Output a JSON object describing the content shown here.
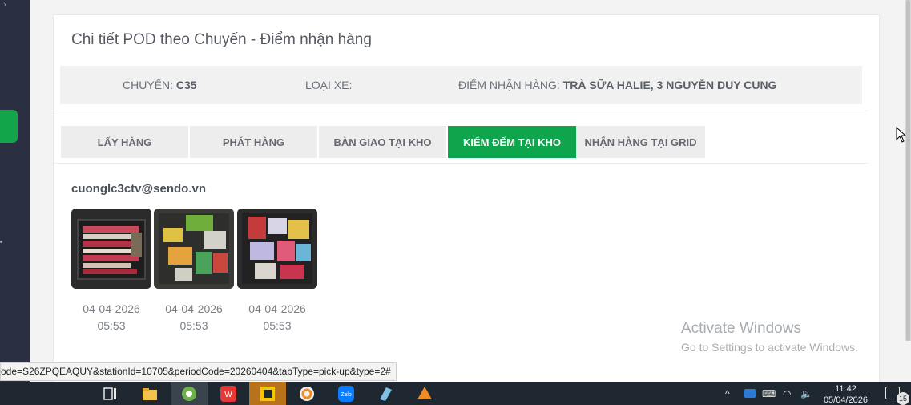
{
  "title": "Chi tiết POD theo Chuyến - Điểm nhận hàng",
  "info": {
    "trip_label": "CHUYẾN:",
    "trip_value": "C35",
    "vehicle_label": "LOẠI XE:",
    "vehicle_value": "",
    "pickup_label": "ĐIỂM NHẬN HÀNG:",
    "pickup_value": "TRÀ SỮA HALIE, 3 NGUYỄN DUY CUNG"
  },
  "tabs": [
    {
      "label": "LẤY HÀNG"
    },
    {
      "label": "PHÁT HÀNG"
    },
    {
      "label": "BÀN GIAO TẠI KHO"
    },
    {
      "label": "KIỂM ĐẾM TẠI KHO"
    },
    {
      "label": "NHẬN HÀNG TẠI GRID"
    }
  ],
  "active_tab": "KIỂM ĐẾM TẠI KHO",
  "uploader_email": "cuonglc3ctv@sendo.vn",
  "photos": [
    {
      "date": "04-04-2026",
      "time": "05:53"
    },
    {
      "date": "04-04-2026",
      "time": "05:53"
    },
    {
      "date": "04-04-2026",
      "time": "05:53"
    }
  ],
  "watermark": {
    "line1": "Activate Windows",
    "line2": "Go to Settings to activate Windows."
  },
  "status_url": "ode=S26ZPQEAQUY&stationId=10705&periodCode=20260404&tabType=pick-up&type=2#",
  "taskbar": {
    "time": "11:42",
    "date": "05/04/2026",
    "notification_count": "15",
    "icons": [
      "task-view-icon",
      "file-explorer-icon",
      "browser-icon",
      "wps-office-icon",
      "sticky-notes-icon",
      "ultraviewer-icon",
      "zalo-icon",
      "app-icon",
      "app-icon"
    ]
  },
  "colors": {
    "accent": "#0fa54c",
    "sidebar": "#2a3042",
    "taskbar": "#1f2830"
  }
}
